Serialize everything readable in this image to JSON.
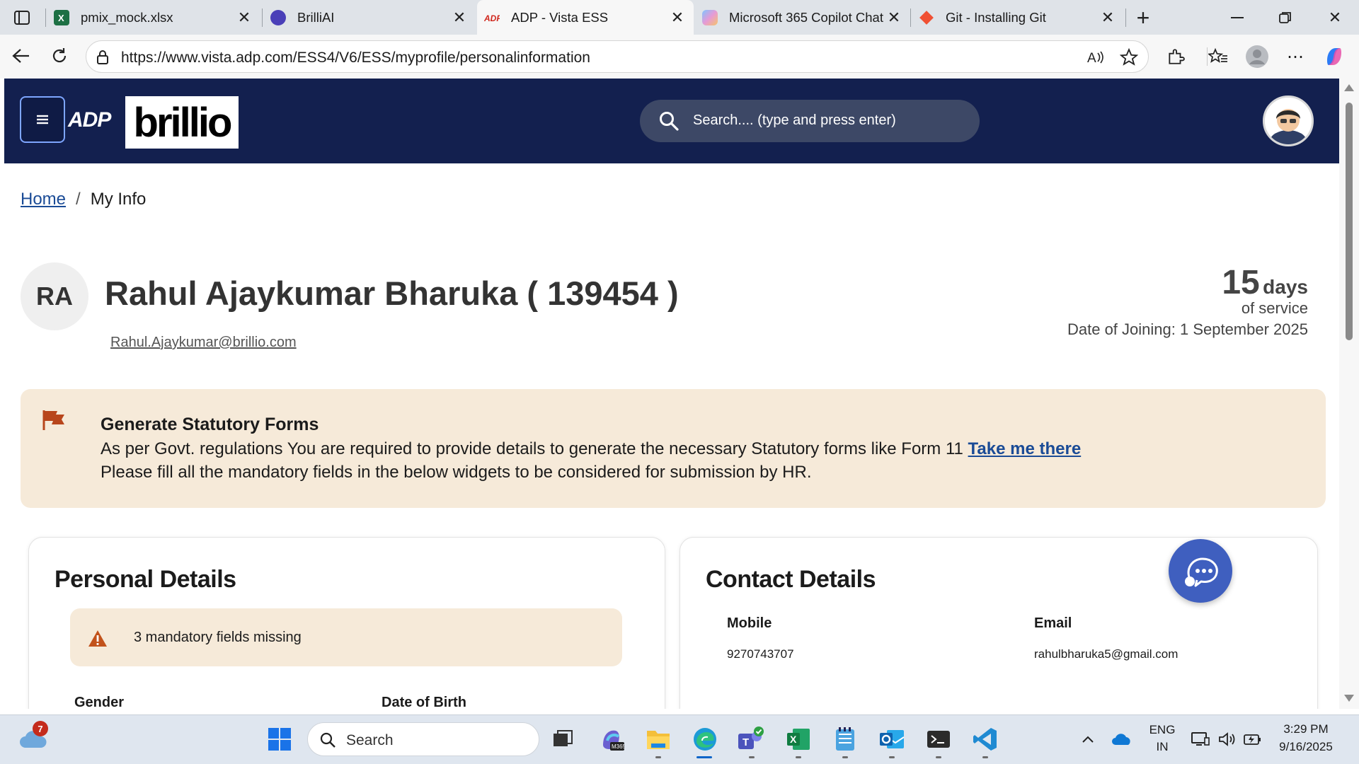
{
  "browser": {
    "tabs": [
      {
        "title": "pmix_mock.xlsx",
        "icon": "excel-icon"
      },
      {
        "title": "BrilliAI",
        "icon": "brilliai-icon"
      },
      {
        "title": "ADP - Vista ESS",
        "icon": "adp-icon",
        "active": true
      },
      {
        "title": "Microsoft 365 Copilot Chat",
        "icon": "copilot-icon"
      },
      {
        "title": "Git - Installing Git",
        "icon": "git-icon"
      }
    ],
    "url": "https://www.vista.adp.com/ESS4/V6/ESS/myprofile/personalinformation"
  },
  "header": {
    "adp_logo": "ADP",
    "brand_logo": "brillio",
    "search_placeholder": "Search.... (type and press enter)",
    "colors": {
      "bar": "#13204f",
      "search": "#3d4866"
    }
  },
  "breadcrumb": {
    "home": "Home",
    "separator": "/",
    "current": "My Info"
  },
  "profile": {
    "initials": "RA",
    "name": "Rahul Ajaykumar Bharuka ( 139454 )",
    "email": "Rahul.Ajaykumar@brillio.com",
    "service_days": "15",
    "service_unit": "days",
    "service_label": "of service",
    "date_of_joining": "Date of Joining: 1 September 2025"
  },
  "statutory_alert": {
    "title": "Generate Statutory Forms",
    "line1": "As per Govt. regulations You are required to provide details to generate the necessary Statutory forms like Form 11",
    "link": "Take me there",
    "line2": "Please fill all the mandatory fields in the below widgets to be considered for submission by HR.",
    "color": "#f6ead9"
  },
  "personal_details": {
    "title": "Personal Details",
    "missing_notice": "3 mandatory fields missing",
    "fields": [
      {
        "label": "Gender"
      },
      {
        "label": "Date of Birth"
      }
    ]
  },
  "contact_details": {
    "title": "Contact Details",
    "fields": [
      {
        "label": "Mobile",
        "value": "9270743707"
      },
      {
        "label": "Email",
        "value": "rahulbharuka5@gmail.com"
      }
    ]
  },
  "taskbar": {
    "weather_badge": "7",
    "search_placeholder": "Search",
    "apps": [
      "windows-start-icon",
      "task-view-icon",
      "m365-icon",
      "file-explorer-icon",
      "edge-icon",
      "teams-icon",
      "excel-icon",
      "notepad-icon",
      "outlook-icon",
      "terminal-icon",
      "vscode-icon"
    ],
    "language": "ENG",
    "region": "IN",
    "time": "3:29 PM",
    "date": "9/16/2025"
  }
}
